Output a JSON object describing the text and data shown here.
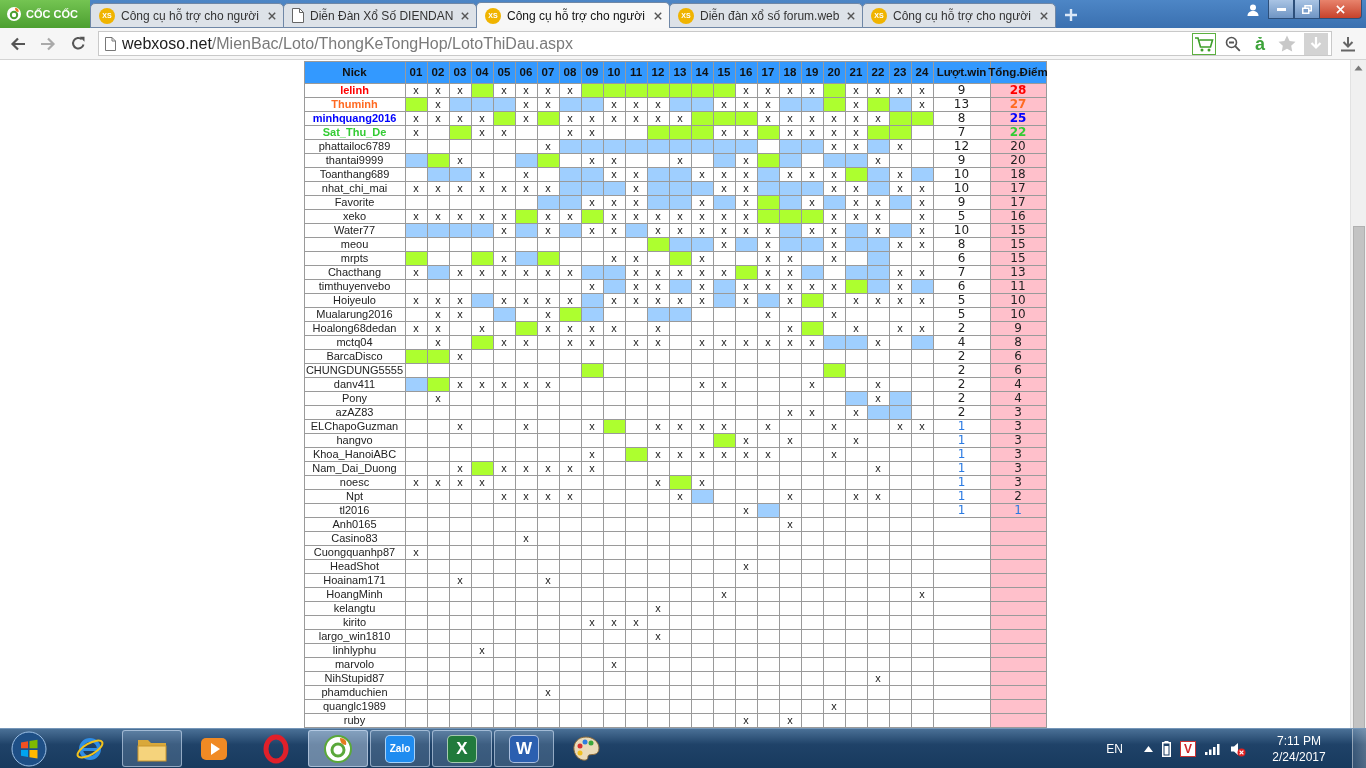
{
  "browser": {
    "menu_label": "CỐC CỐC",
    "tabs": [
      {
        "title": "Công cụ hỗ trợ cho người",
        "kind": "site",
        "favicon_text": "XS",
        "selected": false
      },
      {
        "title": "Diễn Đàn Xổ Số DIENDAN",
        "kind": "document",
        "selected": false
      },
      {
        "title": "Công cụ hỗ trợ cho người",
        "kind": "site",
        "favicon_text": "XS",
        "selected": true
      },
      {
        "title": "Diễn đàn xổ số forum.web",
        "kind": "site",
        "favicon_text": "XS",
        "selected": false
      },
      {
        "title": "Công cụ hỗ trợ cho người",
        "kind": "site",
        "favicon_text": "XS",
        "selected": false
      }
    ]
  },
  "address_bar": {
    "host": "webxoso.net",
    "path": "/MienBac/Loto/ThongKeTongHop/LotoThiDau.aspx",
    "dictionary_glyph": "ả"
  },
  "table": {
    "columns": [
      "Nick",
      "01",
      "02",
      "03",
      "04",
      "05",
      "06",
      "07",
      "08",
      "09",
      "10",
      "11",
      "12",
      "13",
      "14",
      "15",
      "16",
      "17",
      "18",
      "19",
      "20",
      "21",
      "22",
      "23",
      "24",
      "Lượt.win",
      "Tổng.Điểm"
    ],
    "rows": [
      {
        "cells": [
          {
            "text": "lelinh",
            "color": "#ff0000",
            "bold": true
          },
          "x",
          "x",
          "x",
          {
            "color": "#adff2f"
          },
          "x",
          "x",
          "x",
          "x",
          {
            "color": "#adff2f"
          },
          {
            "color": "#adff2f"
          },
          {
            "color": "#adff2f"
          },
          {
            "color": "#adff2f"
          },
          {
            "color": "#adff2f"
          },
          {
            "color": "#adff2f"
          },
          {
            "color": "#adff2f"
          },
          "x",
          "x",
          "x",
          "x",
          {
            "color": "#adff2f"
          },
          "x",
          "x",
          "x",
          "x",
          "9",
          {
            "text": "28",
            "color": "#ff0000",
            "bold": true
          }
        ]
      },
      {
        "cells": [
          {
            "text": "Thuminh",
            "color": "#ff6a22",
            "bold": true
          },
          {
            "color": "#adff2f"
          },
          "x",
          {
            "color": "#9fcfff"
          },
          {
            "color": "#9fcfff"
          },
          {
            "color": "#9fcfff"
          },
          "x",
          "x",
          {
            "color": "#9fcfff"
          },
          {
            "color": "#9fcfff"
          },
          "x",
          "x",
          "x",
          {
            "color": "#9fcfff"
          },
          {
            "color": "#9fcfff"
          },
          "x",
          "x",
          "x",
          {
            "color": "#9fcfff"
          },
          {
            "color": "#9fcfff"
          },
          {
            "color": "#adff2f"
          },
          "x",
          {
            "color": "#adff2f"
          },
          {
            "color": "#9fcfff"
          },
          "x",
          "13",
          {
            "text": "27",
            "color": "#ff6a22",
            "bold": true
          }
        ]
      },
      {
        "cells": [
          {
            "text": "minhquang2016",
            "color": "#0000ff",
            "bold": true
          },
          "x",
          "x",
          "x",
          "x",
          {
            "color": "#adff2f"
          },
          "x",
          {
            "color": "#adff2f"
          },
          "x",
          "x",
          "x",
          "x",
          "x",
          "x",
          {
            "color": "#adff2f"
          },
          {
            "color": "#adff2f"
          },
          {
            "color": "#adff2f"
          },
          "x",
          "x",
          "x",
          "x",
          "x",
          "x",
          {
            "color": "#adff2f"
          },
          {
            "color": "#adff2f"
          },
          "8",
          {
            "text": "25",
            "color": "#0000ff",
            "bold": true
          }
        ]
      },
      {
        "cells": [
          {
            "text": "Sat_Thu_De",
            "color": "#33cc33",
            "bold": true
          },
          "x",
          null,
          {
            "color": "#adff2f"
          },
          "x",
          "x",
          null,
          null,
          "x",
          "x",
          null,
          null,
          {
            "color": "#adff2f"
          },
          {
            "color": "#adff2f"
          },
          {
            "color": "#adff2f"
          },
          "x",
          "x",
          {
            "color": "#adff2f"
          },
          "x",
          "x",
          "x",
          "x",
          {
            "color": "#adff2f"
          },
          {
            "color": "#adff2f"
          },
          null,
          "7",
          {
            "text": "22",
            "color": "#33cc33",
            "bold": true
          }
        ]
      },
      {
        "cells": [
          "phattailoc6789",
          null,
          null,
          null,
          null,
          null,
          null,
          "x",
          {
            "color": "#9fcfff"
          },
          {
            "color": "#9fcfff"
          },
          {
            "color": "#9fcfff"
          },
          {
            "color": "#9fcfff"
          },
          {
            "color": "#9fcfff"
          },
          {
            "color": "#9fcfff"
          },
          {
            "color": "#9fcfff"
          },
          {
            "color": "#9fcfff"
          },
          {
            "color": "#9fcfff"
          },
          null,
          {
            "color": "#9fcfff"
          },
          {
            "color": "#9fcfff"
          },
          "x",
          "x",
          {
            "color": "#9fcfff"
          },
          "x",
          null,
          "12",
          "20"
        ]
      },
      {
        "cells": [
          "thantai9999",
          {
            "color": "#9fcfff"
          },
          {
            "color": "#adff2f"
          },
          "x",
          null,
          null,
          {
            "color": "#9fcfff"
          },
          {
            "color": "#adff2f"
          },
          null,
          "x",
          "x",
          null,
          null,
          "x",
          null,
          {
            "color": "#9fcfff"
          },
          "x",
          {
            "color": "#adff2f"
          },
          {
            "color": "#9fcfff"
          },
          null,
          {
            "color": "#9fcfff"
          },
          {
            "color": "#9fcfff"
          },
          "x",
          null,
          null,
          "9",
          "20"
        ]
      },
      {
        "cells": [
          "Toanthang689",
          null,
          {
            "color": "#9fcfff"
          },
          {
            "color": "#9fcfff"
          },
          "x",
          null,
          "x",
          null,
          {
            "color": "#9fcfff"
          },
          {
            "color": "#9fcfff"
          },
          "x",
          "x",
          {
            "color": "#9fcfff"
          },
          {
            "color": "#9fcfff"
          },
          "x",
          "x",
          "x",
          {
            "color": "#9fcfff"
          },
          "x",
          "x",
          "x",
          {
            "color": "#adff2f"
          },
          {
            "color": "#9fcfff"
          },
          "x",
          {
            "color": "#9fcfff"
          },
          "10",
          "18"
        ]
      },
      {
        "cells": [
          "nhat_chi_mai",
          "x",
          "x",
          "x",
          "x",
          "x",
          "x",
          "x",
          {
            "color": "#9fcfff"
          },
          {
            "color": "#9fcfff"
          },
          {
            "color": "#9fcfff"
          },
          "x",
          {
            "color": "#9fcfff"
          },
          {
            "color": "#9fcfff"
          },
          {
            "color": "#9fcfff"
          },
          "x",
          "x",
          {
            "color": "#9fcfff"
          },
          {
            "color": "#9fcfff"
          },
          {
            "color": "#9fcfff"
          },
          "x",
          "x",
          {
            "color": "#9fcfff"
          },
          "x",
          "x",
          "10",
          "17"
        ]
      },
      {
        "cells": [
          "Favorite",
          null,
          null,
          null,
          null,
          null,
          null,
          {
            "color": "#9fcfff"
          },
          {
            "color": "#9fcfff"
          },
          "x",
          "x",
          "x",
          {
            "color": "#9fcfff"
          },
          {
            "color": "#9fcfff"
          },
          "x",
          {
            "color": "#9fcfff"
          },
          "x",
          {
            "color": "#adff2f"
          },
          {
            "color": "#9fcfff"
          },
          "x",
          {
            "color": "#9fcfff"
          },
          "x",
          "x",
          {
            "color": "#9fcfff"
          },
          "x",
          "9",
          "17"
        ]
      },
      {
        "cells": [
          "xeko",
          "x",
          "x",
          "x",
          "x",
          "x",
          {
            "color": "#adff2f"
          },
          "x",
          "x",
          {
            "color": "#adff2f"
          },
          "x",
          "x",
          "x",
          "x",
          "x",
          "x",
          "x",
          {
            "color": "#adff2f"
          },
          {
            "color": "#adff2f"
          },
          {
            "color": "#adff2f"
          },
          "x",
          "x",
          "x",
          null,
          "x",
          "5",
          "16"
        ]
      },
      {
        "cells": [
          "Water77",
          {
            "color": "#9fcfff"
          },
          {
            "color": "#9fcfff"
          },
          {
            "color": "#9fcfff"
          },
          {
            "color": "#9fcfff"
          },
          "x",
          {
            "color": "#9fcfff"
          },
          "x",
          {
            "color": "#9fcfff"
          },
          "x",
          "x",
          {
            "color": "#9fcfff"
          },
          "x",
          "x",
          "x",
          "x",
          "x",
          "x",
          {
            "color": "#9fcfff"
          },
          "x",
          "x",
          {
            "color": "#9fcfff"
          },
          "x",
          {
            "color": "#9fcfff"
          },
          "x",
          "10",
          "15"
        ]
      },
      {
        "cells": [
          "meou",
          null,
          null,
          null,
          null,
          null,
          null,
          null,
          null,
          null,
          null,
          null,
          {
            "color": "#adff2f"
          },
          {
            "color": "#9fcfff"
          },
          {
            "color": "#9fcfff"
          },
          "x",
          {
            "color": "#9fcfff"
          },
          "x",
          {
            "color": "#9fcfff"
          },
          {
            "color": "#9fcfff"
          },
          "x",
          {
            "color": "#9fcfff"
          },
          {
            "color": "#9fcfff"
          },
          "x",
          "x",
          "8",
          "15"
        ]
      },
      {
        "cells": [
          "mrpts",
          {
            "color": "#adff2f"
          },
          null,
          null,
          {
            "color": "#adff2f"
          },
          "x",
          {
            "color": "#9fcfff"
          },
          {
            "color": "#adff2f"
          },
          null,
          null,
          "x",
          "x",
          null,
          {
            "color": "#adff2f"
          },
          "x",
          null,
          null,
          "x",
          "x",
          null,
          "x",
          null,
          {
            "color": "#9fcfff"
          },
          null,
          null,
          "6",
          "15"
        ]
      },
      {
        "cells": [
          "Chacthang",
          "x",
          {
            "color": "#9fcfff"
          },
          "x",
          "x",
          "x",
          "x",
          "x",
          "x",
          {
            "color": "#9fcfff"
          },
          {
            "color": "#9fcfff"
          },
          "x",
          "x",
          "x",
          "x",
          "x",
          {
            "color": "#adff2f"
          },
          "x",
          "x",
          {
            "color": "#9fcfff"
          },
          null,
          {
            "color": "#9fcfff"
          },
          {
            "color": "#9fcfff"
          },
          "x",
          "x",
          "7",
          "13"
        ]
      },
      {
        "cells": [
          "timthuyenvebo",
          null,
          null,
          null,
          null,
          null,
          null,
          null,
          null,
          "x",
          {
            "color": "#9fcfff"
          },
          "x",
          "x",
          {
            "color": "#9fcfff"
          },
          "x",
          {
            "color": "#9fcfff"
          },
          "x",
          "x",
          "x",
          "x",
          "x",
          {
            "color": "#adff2f"
          },
          {
            "color": "#9fcfff"
          },
          "x",
          {
            "color": "#9fcfff"
          },
          "6",
          "11"
        ]
      },
      {
        "cells": [
          "Hoiyeulo",
          "x",
          "x",
          "x",
          {
            "color": "#9fcfff"
          },
          "x",
          "x",
          "x",
          "x",
          {
            "color": "#9fcfff"
          },
          "x",
          "x",
          "x",
          "x",
          "x",
          {
            "color": "#9fcfff"
          },
          "x",
          {
            "color": "#9fcfff"
          },
          "x",
          {
            "color": "#adff2f"
          },
          null,
          "x",
          "x",
          "x",
          "x",
          "5",
          "10"
        ]
      },
      {
        "cells": [
          "Mualarung2016",
          null,
          "x",
          "x",
          null,
          {
            "color": "#9fcfff"
          },
          null,
          "x",
          {
            "color": "#adff2f"
          },
          {
            "color": "#9fcfff"
          },
          null,
          null,
          {
            "color": "#9fcfff"
          },
          {
            "color": "#9fcfff"
          },
          null,
          null,
          null,
          "x",
          null,
          null,
          "x",
          null,
          null,
          null,
          null,
          "5",
          "10"
        ]
      },
      {
        "cells": [
          "Hoalong68dedan",
          "x",
          "x",
          null,
          "x",
          null,
          {
            "color": "#adff2f"
          },
          "x",
          "x",
          "x",
          "x",
          null,
          "x",
          null,
          null,
          null,
          null,
          null,
          "x",
          {
            "color": "#adff2f"
          },
          null,
          "x",
          null,
          "x",
          "x",
          "2",
          "9"
        ]
      },
      {
        "cells": [
          "mctq04",
          null,
          "x",
          null,
          {
            "color": "#adff2f"
          },
          "x",
          "x",
          null,
          "x",
          "x",
          null,
          "x",
          "x",
          null,
          "x",
          "x",
          "x",
          "x",
          "x",
          "x",
          {
            "color": "#9fcfff"
          },
          {
            "color": "#9fcfff"
          },
          "x",
          null,
          {
            "color": "#9fcfff"
          },
          "4",
          "8"
        ]
      },
      {
        "cells": [
          "BarcaDisco",
          {
            "color": "#adff2f"
          },
          {
            "color": "#adff2f"
          },
          "x",
          null,
          null,
          null,
          null,
          null,
          null,
          null,
          null,
          null,
          null,
          null,
          null,
          null,
          null,
          null,
          null,
          null,
          null,
          null,
          null,
          null,
          "2",
          "6"
        ]
      },
      {
        "cells": [
          "CHUNGDUNG5555",
          null,
          null,
          null,
          null,
          null,
          null,
          null,
          null,
          {
            "color": "#adff2f"
          },
          null,
          null,
          null,
          null,
          null,
          null,
          null,
          null,
          null,
          null,
          {
            "color": "#adff2f"
          },
          null,
          null,
          null,
          null,
          "2",
          "6"
        ]
      },
      {
        "cells": [
          "danv411",
          {
            "color": "#9fcfff"
          },
          {
            "color": "#adff2f"
          },
          "x",
          "x",
          "x",
          "x",
          "x",
          null,
          null,
          null,
          null,
          null,
          null,
          "x",
          "x",
          null,
          null,
          null,
          "x",
          null,
          null,
          "x",
          null,
          null,
          "2",
          "4"
        ]
      },
      {
        "cells": [
          "Pony",
          null,
          "x",
          null,
          null,
          null,
          null,
          null,
          null,
          null,
          null,
          null,
          null,
          null,
          null,
          null,
          null,
          null,
          null,
          null,
          null,
          {
            "color": "#9fcfff"
          },
          "x",
          {
            "color": "#9fcfff"
          },
          null,
          "2",
          "4"
        ]
      },
      {
        "cells": [
          "azAZ83",
          null,
          null,
          null,
          null,
          null,
          null,
          null,
          null,
          null,
          null,
          null,
          null,
          null,
          null,
          null,
          null,
          null,
          "x",
          "x",
          null,
          "x",
          {
            "color": "#9fcfff"
          },
          {
            "color": "#9fcfff"
          },
          null,
          "2",
          "3"
        ]
      },
      {
        "cells": [
          "ELChapoGuzman",
          null,
          null,
          "x",
          null,
          null,
          "x",
          null,
          null,
          "x",
          {
            "color": "#adff2f"
          },
          null,
          "x",
          "x",
          "x",
          "x",
          null,
          "x",
          null,
          null,
          "x",
          null,
          null,
          "x",
          "x",
          {
            "text": "1",
            "color": "#2a7ae2"
          },
          "3"
        ]
      },
      {
        "cells": [
          "hangvo",
          null,
          null,
          null,
          null,
          null,
          null,
          null,
          null,
          null,
          null,
          null,
          null,
          null,
          null,
          {
            "color": "#adff2f"
          },
          "x",
          null,
          "x",
          null,
          null,
          "x",
          null,
          null,
          null,
          {
            "text": "1",
            "color": "#2a7ae2"
          },
          "3"
        ]
      },
      {
        "cells": [
          "Khoa_HanoiABC",
          null,
          null,
          null,
          null,
          null,
          null,
          null,
          null,
          "x",
          null,
          {
            "color": "#adff2f"
          },
          "x",
          "x",
          "x",
          "x",
          "x",
          "x",
          null,
          null,
          "x",
          null,
          null,
          null,
          null,
          {
            "text": "1",
            "color": "#2a7ae2"
          },
          "3"
        ]
      },
      {
        "cells": [
          "Nam_Dai_Duong",
          null,
          null,
          "x",
          {
            "color": "#adff2f"
          },
          "x",
          "x",
          "x",
          "x",
          "x",
          null,
          null,
          null,
          null,
          null,
          null,
          null,
          null,
          null,
          null,
          null,
          null,
          "x",
          null,
          null,
          {
            "text": "1",
            "color": "#2a7ae2"
          },
          "3"
        ]
      },
      {
        "cells": [
          "noesc",
          "x",
          "x",
          "x",
          "x",
          null,
          null,
          null,
          null,
          null,
          null,
          null,
          "x",
          {
            "color": "#adff2f"
          },
          "x",
          null,
          null,
          null,
          null,
          null,
          null,
          null,
          null,
          null,
          null,
          {
            "text": "1",
            "color": "#2a7ae2"
          },
          "3"
        ]
      },
      {
        "cells": [
          "Npt",
          null,
          null,
          null,
          null,
          "x",
          "x",
          "x",
          "x",
          null,
          null,
          null,
          null,
          "x",
          {
            "color": "#9fcfff"
          },
          null,
          null,
          null,
          "x",
          null,
          null,
          "x",
          "x",
          null,
          null,
          {
            "text": "1",
            "color": "#2a7ae2"
          },
          "2"
        ]
      },
      {
        "cells": [
          "tl2016",
          null,
          null,
          null,
          null,
          null,
          null,
          null,
          null,
          null,
          null,
          null,
          null,
          null,
          null,
          null,
          "x",
          {
            "color": "#9fcfff"
          },
          null,
          null,
          null,
          null,
          null,
          null,
          null,
          {
            "text": "1",
            "color": "#2a7ae2"
          },
          {
            "text": "1",
            "color": "#2a7ae2"
          }
        ]
      },
      {
        "cells": [
          "Anh0165",
          null,
          null,
          null,
          null,
          null,
          null,
          null,
          null,
          null,
          null,
          null,
          null,
          null,
          null,
          null,
          null,
          null,
          "x",
          null,
          null,
          null,
          null,
          null,
          null,
          null,
          null
        ]
      },
      {
        "cells": [
          "Casino83",
          null,
          null,
          null,
          null,
          null,
          "x",
          null,
          null,
          null,
          null,
          null,
          null,
          null,
          null,
          null,
          null,
          null,
          null,
          null,
          null,
          null,
          null,
          null,
          null,
          null,
          null
        ]
      },
      {
        "cells": [
          "Cuongquanhp87",
          "x",
          null,
          null,
          null,
          null,
          null,
          null,
          null,
          null,
          null,
          null,
          null,
          null,
          null,
          null,
          null,
          null,
          null,
          null,
          null,
          null,
          null,
          null,
          null,
          null,
          null
        ]
      },
      {
        "cells": [
          "HeadShot",
          null,
          null,
          null,
          null,
          null,
          null,
          null,
          null,
          null,
          null,
          null,
          null,
          null,
          null,
          null,
          "x",
          null,
          null,
          null,
          null,
          null,
          null,
          null,
          null,
          null,
          null
        ]
      },
      {
        "cells": [
          "Hoainam171",
          null,
          null,
          "x",
          null,
          null,
          null,
          "x",
          null,
          null,
          null,
          null,
          null,
          null,
          null,
          null,
          null,
          null,
          null,
          null,
          null,
          null,
          null,
          null,
          null,
          null,
          null
        ]
      },
      {
        "cells": [
          "HoangMinh",
          null,
          null,
          null,
          null,
          null,
          null,
          null,
          null,
          null,
          null,
          null,
          null,
          null,
          null,
          "x",
          null,
          null,
          null,
          null,
          null,
          null,
          null,
          null,
          "x",
          null,
          null
        ]
      },
      {
        "cells": [
          "kelangtu",
          null,
          null,
          null,
          null,
          null,
          null,
          null,
          null,
          null,
          null,
          null,
          "x",
          null,
          null,
          null,
          null,
          null,
          null,
          null,
          null,
          null,
          null,
          null,
          null,
          null,
          null
        ]
      },
      {
        "cells": [
          "kirito",
          null,
          null,
          null,
          null,
          null,
          null,
          null,
          null,
          "x",
          "x",
          "x",
          null,
          null,
          null,
          null,
          null,
          null,
          null,
          null,
          null,
          null,
          null,
          null,
          null,
          null,
          null
        ]
      },
      {
        "cells": [
          "largo_win1810",
          null,
          null,
          null,
          null,
          null,
          null,
          null,
          null,
          null,
          null,
          null,
          "x",
          null,
          null,
          null,
          null,
          null,
          null,
          null,
          null,
          null,
          null,
          null,
          null,
          null,
          null
        ]
      },
      {
        "cells": [
          "linhlyphu",
          null,
          null,
          null,
          "x",
          null,
          null,
          null,
          null,
          null,
          null,
          null,
          null,
          null,
          null,
          null,
          null,
          null,
          null,
          null,
          null,
          null,
          null,
          null,
          null,
          null,
          null
        ]
      },
      {
        "cells": [
          "marvolo",
          null,
          null,
          null,
          null,
          null,
          null,
          null,
          null,
          null,
          "x",
          null,
          null,
          null,
          null,
          null,
          null,
          null,
          null,
          null,
          null,
          null,
          null,
          null,
          null,
          null,
          null
        ]
      },
      {
        "cells": [
          "NihStupid87",
          null,
          null,
          null,
          null,
          null,
          null,
          null,
          null,
          null,
          null,
          null,
          null,
          null,
          null,
          null,
          null,
          null,
          null,
          null,
          null,
          null,
          "x",
          null,
          null,
          null,
          null
        ]
      },
      {
        "cells": [
          "phamduchien",
          null,
          null,
          null,
          null,
          null,
          null,
          "x",
          null,
          null,
          null,
          null,
          null,
          null,
          null,
          null,
          null,
          null,
          null,
          null,
          null,
          null,
          null,
          null,
          null,
          null,
          null
        ]
      },
      {
        "cells": [
          "quanglc1989",
          null,
          null,
          null,
          null,
          null,
          null,
          null,
          null,
          null,
          null,
          null,
          null,
          null,
          null,
          null,
          null,
          null,
          null,
          null,
          "x",
          null,
          null,
          null,
          null,
          null,
          null
        ]
      },
      {
        "cells": [
          "ruby",
          null,
          null,
          null,
          null,
          null,
          null,
          null,
          null,
          null,
          null,
          null,
          null,
          null,
          null,
          null,
          "x",
          null,
          "x",
          null,
          null,
          null,
          null,
          null,
          null,
          null,
          null
        ]
      }
    ]
  },
  "taskbar": {
    "apps": [
      {
        "kind": "ie",
        "open": false,
        "selected": false
      },
      {
        "kind": "explorer",
        "open": true,
        "selected": false
      },
      {
        "kind": "media",
        "open": false,
        "selected": false
      },
      {
        "kind": "opera",
        "open": false,
        "selected": false
      },
      {
        "kind": "coccoc",
        "open": true,
        "selected": true
      },
      {
        "kind": "zalo",
        "label": "Zalo",
        "open": true,
        "selected": false
      },
      {
        "kind": "excel",
        "glyph": "X",
        "open": true,
        "selected": false
      },
      {
        "kind": "word",
        "glyph": "W",
        "open": true,
        "selected": false
      },
      {
        "kind": "paint",
        "open": false,
        "selected": false
      }
    ],
    "tray": {
      "language": "EN",
      "antivirus_glyph": "V",
      "time": "7:11 PM",
      "date": "2/24/2017"
    }
  }
}
